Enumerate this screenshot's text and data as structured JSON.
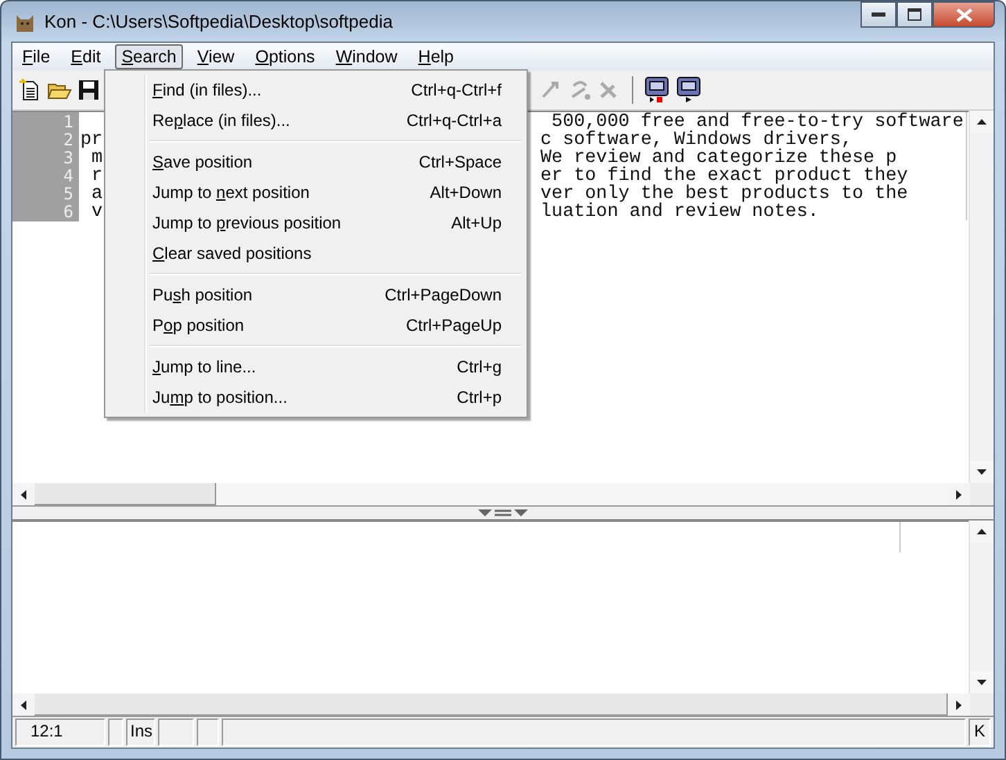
{
  "window": {
    "title": "Kon - C:\\Users\\Softpedia\\Desktop\\softpedia"
  },
  "menubar": [
    {
      "key": "F",
      "post": "ile",
      "selected": false
    },
    {
      "key": "E",
      "post": "dit",
      "selected": false
    },
    {
      "key": "S",
      "post": "earch",
      "selected": true
    },
    {
      "key": "V",
      "post": "iew",
      "selected": false
    },
    {
      "key": "O",
      "post": "ptions",
      "selected": false
    },
    {
      "key": "W",
      "post": "indow",
      "selected": false
    },
    {
      "key": "H",
      "post": "elp",
      "selected": false
    }
  ],
  "search_menu": [
    {
      "kind": "item",
      "key": "F",
      "post": "ind (in files)...",
      "shortcut": "Ctrl+q-Ctrl+f"
    },
    {
      "kind": "item",
      "pre": "Re",
      "key": "p",
      "post": "lace (in files)...",
      "shortcut": "Ctrl+q-Ctrl+a"
    },
    {
      "kind": "separator"
    },
    {
      "kind": "item",
      "key": "S",
      "post": "ave position",
      "shortcut": "Ctrl+Space"
    },
    {
      "kind": "item",
      "pre": "Jump to ",
      "key": "n",
      "post": "ext position",
      "shortcut": "Alt+Down"
    },
    {
      "kind": "item",
      "pre": "Jump to ",
      "key": "p",
      "post": "revious position",
      "shortcut": "Alt+Up"
    },
    {
      "kind": "item",
      "key": "C",
      "post": "lear saved positions"
    },
    {
      "kind": "separator"
    },
    {
      "kind": "item",
      "pre": "Pu",
      "key": "s",
      "post": "h position",
      "shortcut": "Ctrl+PageDown"
    },
    {
      "kind": "item",
      "pre": "P",
      "key": "o",
      "post": "p position",
      "shortcut": "Ctrl+PageUp"
    },
    {
      "kind": "separator"
    },
    {
      "kind": "item",
      "key": "J",
      "post": "ump to line...",
      "shortcut": "Ctrl+g"
    },
    {
      "kind": "item",
      "pre": "Ju",
      "key": "m",
      "post": "p to position...",
      "shortcut": "Ctrl+p"
    }
  ],
  "editor": {
    "lines": [
      {
        "number": "1",
        "right": " 500,000 free and free-to-try software"
      },
      {
        "number": "2",
        "left": "pr",
        "right": "c software, Windows drivers,"
      },
      {
        "number": "3",
        "left": " m",
        "right": "We review and categorize these p"
      },
      {
        "number": "4",
        "left": " r",
        "right": "er to find the exact product they"
      },
      {
        "number": "5",
        "left": " a",
        "right": "ver only the best products to the"
      },
      {
        "number": "6",
        "left": " v",
        "right": "luation and review notes."
      }
    ]
  },
  "status_bar": [
    {
      "kind": "text",
      "text": "12:1"
    },
    {
      "kind": "blank"
    },
    {
      "kind": "text",
      "text": "Ins"
    },
    {
      "kind": "blank"
    },
    {
      "kind": "blank"
    },
    {
      "kind": "blank"
    },
    {
      "kind": "text",
      "text": "K"
    }
  ]
}
